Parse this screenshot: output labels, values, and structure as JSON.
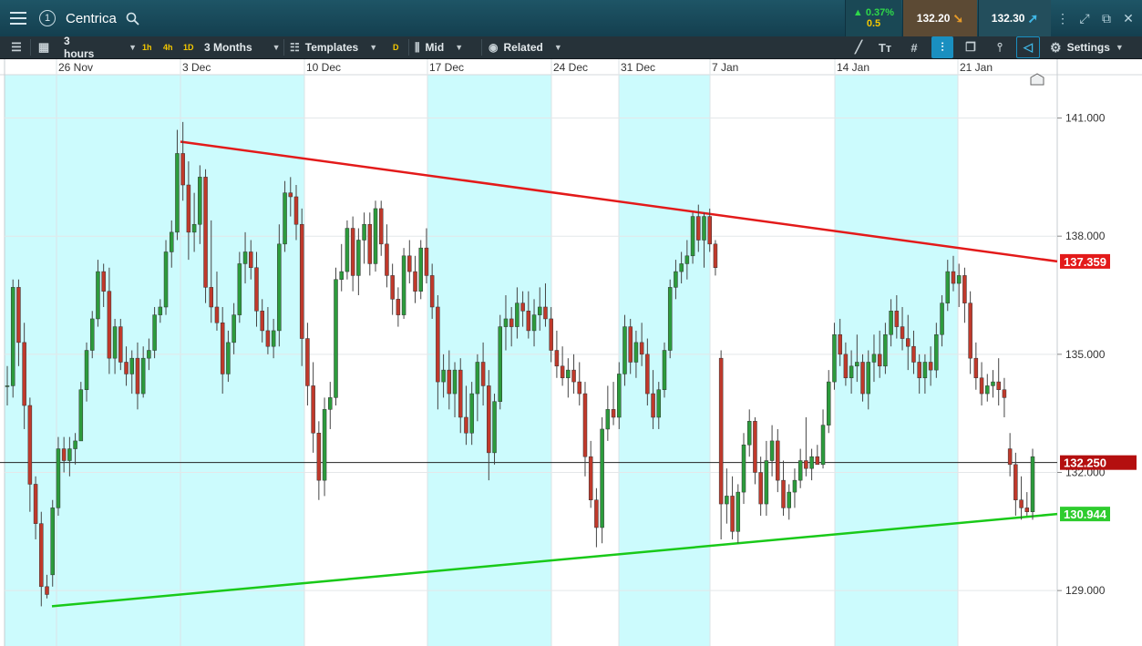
{
  "header": {
    "menu_icon": "hamburger-menu-icon",
    "alert_icon": "alert-circle-icon",
    "alert_label": "1",
    "title": "Centrica",
    "search_icon": "search-icon",
    "change_pct": "▲ 0.37%",
    "change_abs": "0.5",
    "sell_price": "132.20",
    "buy_price": "132.30",
    "window_icons": [
      "menu-dots-icon",
      "expand-icon",
      "popout-icon",
      "close-icon"
    ],
    "window_glyphs": [
      "⋮",
      "⤢",
      "⧉",
      "✕"
    ]
  },
  "toolbar": {
    "interval": "3 hours",
    "quick_1h": "1h",
    "quick_4h": "4h",
    "quick_1d": "1D",
    "range": "3 Months",
    "templates": "Templates",
    "d_label": "D",
    "price_type": "Mid",
    "related": "Related",
    "settings": "Settings"
  },
  "colors": {
    "up": "#2c9b3c",
    "down": "#c0392b",
    "resistance": "#e31a1a",
    "support": "#19c919",
    "shade": "#ccfbfd",
    "current": "#b40f0f"
  },
  "chart_data": {
    "type": "candlestick",
    "x_labels": [
      "26 Nov",
      "3 Dec",
      "10 Dec",
      "17 Dec",
      "24 Dec",
      "31 Dec",
      "7 Jan",
      "14 Jan",
      "21 Jan"
    ],
    "y_ticks": [
      "141.000",
      "138.000",
      "135.000",
      "132.000",
      "129.000"
    ],
    "y_range": [
      127.8,
      142.1
    ],
    "current_price_label": "132.250",
    "current_price": 132.25,
    "resistance_label": "137.359",
    "resistance": {
      "from": {
        "date": "3 Dec",
        "price": 140.4
      },
      "to_price": 137.359
    },
    "support_label": "130.944",
    "support": {
      "from": {
        "date": "26 Nov",
        "price": 128.6
      },
      "to_price": 130.944
    },
    "shaded_weeks": [
      "26 Nov",
      "3 Dec",
      "17 Dec",
      "31 Dec",
      "14 Jan"
    ],
    "candles": [
      [
        134.2,
        134.7,
        133.7,
        134.2
      ],
      [
        134.2,
        136.9,
        133.9,
        136.7
      ],
      [
        136.7,
        136.9,
        134.7,
        135.3
      ],
      [
        135.3,
        135.8,
        133.1,
        133.7
      ],
      [
        133.7,
        133.9,
        131.0,
        131.7
      ],
      [
        131.7,
        131.9,
        130.3,
        130.7
      ],
      [
        130.7,
        131.0,
        128.6,
        129.1
      ],
      [
        129.1,
        129.4,
        128.8,
        128.9
      ],
      [
        129.4,
        131.3,
        129.1,
        131.1
      ],
      [
        131.1,
        132.9,
        130.9,
        132.6
      ],
      [
        132.6,
        132.9,
        132.0,
        132.3
      ],
      [
        132.3,
        132.9,
        131.9,
        132.6
      ],
      [
        132.6,
        133.0,
        132.2,
        132.8
      ],
      [
        132.8,
        134.3,
        132.8,
        134.1
      ],
      [
        134.1,
        135.3,
        133.8,
        135.1
      ],
      [
        135.1,
        136.1,
        134.9,
        135.9
      ],
      [
        135.9,
        137.4,
        135.7,
        137.1
      ],
      [
        137.1,
        137.3,
        136.2,
        136.6
      ],
      [
        136.6,
        137.2,
        134.5,
        134.9
      ],
      [
        134.9,
        135.9,
        134.5,
        135.7
      ],
      [
        135.7,
        135.9,
        134.6,
        134.8
      ],
      [
        134.8,
        135.2,
        134.2,
        134.5
      ],
      [
        134.5,
        135.1,
        134.0,
        134.9
      ],
      [
        134.9,
        135.3,
        133.6,
        134.0
      ],
      [
        134.0,
        135.2,
        133.9,
        134.9
      ],
      [
        134.9,
        135.4,
        134.6,
        135.1
      ],
      [
        135.1,
        136.2,
        134.9,
        136.0
      ],
      [
        136.0,
        136.4,
        135.8,
        136.2
      ],
      [
        136.2,
        137.9,
        136.0,
        137.6
      ],
      [
        137.6,
        138.4,
        137.2,
        138.1
      ],
      [
        138.1,
        140.7,
        137.9,
        140.1
      ],
      [
        140.1,
        140.9,
        138.9,
        139.3
      ],
      [
        139.3,
        139.9,
        137.4,
        138.1
      ],
      [
        138.1,
        139.1,
        137.6,
        138.3
      ],
      [
        138.3,
        139.8,
        137.8,
        139.5
      ],
      [
        139.5,
        139.7,
        136.3,
        136.7
      ],
      [
        136.7,
        138.4,
        135.8,
        136.2
      ],
      [
        136.2,
        137.1,
        135.6,
        135.8
      ],
      [
        135.8,
        136.2,
        134.0,
        134.5
      ],
      [
        134.5,
        135.6,
        134.3,
        135.3
      ],
      [
        135.3,
        136.3,
        135.0,
        136.0
      ],
      [
        136.0,
        137.6,
        135.8,
        137.3
      ],
      [
        137.3,
        138.1,
        136.8,
        137.6
      ],
      [
        137.6,
        137.9,
        136.9,
        137.2
      ],
      [
        137.2,
        137.6,
        135.7,
        136.1
      ],
      [
        136.1,
        136.4,
        135.3,
        135.6
      ],
      [
        135.6,
        136.2,
        135.0,
        135.2
      ],
      [
        135.2,
        135.9,
        134.9,
        135.6
      ],
      [
        135.6,
        138.3,
        135.2,
        137.8
      ],
      [
        137.8,
        139.4,
        137.6,
        139.1
      ],
      [
        139.1,
        139.5,
        138.5,
        139.0
      ],
      [
        139.0,
        139.3,
        137.9,
        138.3
      ],
      [
        138.3,
        138.7,
        134.7,
        135.4
      ],
      [
        135.4,
        135.8,
        133.7,
        134.2
      ],
      [
        134.2,
        134.8,
        132.5,
        133.0
      ],
      [
        133.0,
        133.3,
        131.3,
        131.8
      ],
      [
        131.8,
        133.9,
        131.4,
        133.6
      ],
      [
        133.6,
        134.3,
        133.1,
        133.9
      ],
      [
        133.9,
        137.2,
        133.7,
        136.9
      ],
      [
        136.9,
        137.8,
        136.6,
        137.1
      ],
      [
        137.1,
        138.4,
        136.9,
        138.2
      ],
      [
        138.2,
        138.5,
        136.6,
        137.0
      ],
      [
        137.0,
        138.2,
        136.5,
        137.9
      ],
      [
        137.9,
        138.6,
        137.3,
        138.3
      ],
      [
        138.3,
        138.6,
        137.0,
        137.3
      ],
      [
        137.3,
        138.9,
        137.1,
        138.7
      ],
      [
        138.7,
        138.9,
        137.5,
        137.8
      ],
      [
        137.8,
        138.3,
        136.7,
        137.0
      ],
      [
        137.0,
        137.3,
        136.0,
        136.4
      ],
      [
        136.4,
        136.7,
        135.7,
        136.0
      ],
      [
        136.0,
        137.7,
        135.9,
        137.5
      ],
      [
        137.5,
        137.9,
        136.8,
        137.1
      ],
      [
        137.1,
        137.5,
        136.3,
        136.6
      ],
      [
        136.6,
        137.9,
        136.4,
        137.7
      ],
      [
        137.7,
        138.2,
        136.8,
        137.0
      ],
      [
        137.0,
        137.3,
        135.9,
        136.2
      ],
      [
        136.2,
        136.5,
        133.6,
        134.3
      ],
      [
        134.3,
        135.0,
        133.9,
        134.6
      ],
      [
        134.6,
        135.1,
        133.6,
        134.0
      ],
      [
        134.0,
        134.8,
        133.4,
        134.6
      ],
      [
        134.6,
        134.9,
        133.0,
        133.4
      ],
      [
        133.4,
        134.2,
        132.7,
        133.0
      ],
      [
        133.0,
        134.3,
        132.7,
        134.0
      ],
      [
        134.0,
        135.0,
        133.3,
        134.8
      ],
      [
        134.8,
        135.3,
        133.7,
        134.2
      ],
      [
        134.2,
        134.6,
        131.8,
        132.5
      ],
      [
        132.5,
        134.0,
        132.2,
        133.8
      ],
      [
        133.8,
        136.0,
        133.6,
        135.7
      ],
      [
        135.7,
        136.5,
        135.1,
        135.9
      ],
      [
        135.9,
        136.2,
        135.2,
        135.7
      ],
      [
        135.7,
        136.7,
        135.4,
        136.3
      ],
      [
        136.3,
        136.6,
        135.7,
        136.1
      ],
      [
        136.1,
        136.6,
        135.4,
        135.6
      ],
      [
        135.6,
        136.4,
        135.2,
        136.0
      ],
      [
        136.0,
        136.7,
        135.6,
        136.2
      ],
      [
        136.2,
        136.8,
        135.7,
        135.9
      ],
      [
        135.9,
        136.2,
        134.8,
        135.1
      ],
      [
        135.1,
        135.6,
        134.4,
        134.7
      ],
      [
        134.7,
        135.2,
        134.2,
        134.4
      ],
      [
        134.4,
        134.9,
        133.9,
        134.6
      ],
      [
        134.6,
        135.0,
        134.0,
        134.3
      ],
      [
        134.3,
        134.8,
        133.7,
        134.0
      ],
      [
        134.0,
        134.3,
        131.9,
        132.4
      ],
      [
        132.4,
        132.8,
        131.1,
        131.3
      ],
      [
        131.3,
        131.6,
        130.1,
        130.6
      ],
      [
        130.6,
        133.4,
        130.2,
        133.1
      ],
      [
        133.1,
        134.2,
        132.8,
        133.6
      ],
      [
        133.6,
        134.3,
        133.2,
        133.4
      ],
      [
        133.4,
        134.8,
        133.1,
        134.5
      ],
      [
        134.5,
        136.0,
        134.2,
        135.7
      ],
      [
        135.7,
        135.9,
        134.5,
        134.8
      ],
      [
        134.8,
        135.6,
        134.4,
        135.3
      ],
      [
        135.3,
        135.8,
        134.7,
        135.0
      ],
      [
        135.0,
        135.4,
        133.7,
        134.0
      ],
      [
        134.0,
        134.6,
        133.1,
        133.4
      ],
      [
        133.4,
        134.3,
        133.1,
        134.1
      ],
      [
        134.1,
        135.3,
        133.9,
        135.1
      ],
      [
        135.1,
        136.9,
        134.9,
        136.7
      ],
      [
        136.7,
        137.4,
        136.4,
        137.1
      ],
      [
        137.1,
        137.6,
        136.8,
        137.3
      ],
      [
        137.3,
        137.9,
        136.9,
        137.5
      ],
      [
        137.5,
        138.6,
        137.3,
        138.5
      ],
      [
        138.5,
        138.8,
        137.6,
        137.9
      ],
      [
        137.9,
        138.6,
        137.2,
        138.5
      ],
      [
        138.5,
        138.7,
        137.6,
        137.8
      ],
      [
        137.8,
        137.9,
        137.0,
        137.2
      ],
      [
        134.9,
        135.1,
        130.3,
        131.2
      ],
      [
        131.2,
        132.1,
        130.7,
        131.4
      ],
      [
        131.4,
        131.9,
        130.3,
        130.5
      ],
      [
        130.5,
        131.7,
        130.2,
        131.5
      ],
      [
        131.5,
        133.0,
        131.2,
        132.7
      ],
      [
        132.7,
        133.6,
        132.4,
        133.3
      ],
      [
        133.3,
        133.4,
        131.7,
        132.0
      ],
      [
        132.0,
        132.4,
        130.9,
        131.2
      ],
      [
        131.2,
        132.8,
        130.9,
        132.3
      ],
      [
        132.3,
        133.2,
        131.9,
        132.8
      ],
      [
        132.8,
        133.1,
        131.5,
        131.8
      ],
      [
        131.8,
        132.3,
        130.9,
        131.1
      ],
      [
        131.1,
        131.7,
        130.8,
        131.5
      ],
      [
        131.5,
        132.1,
        131.1,
        131.8
      ],
      [
        131.8,
        132.6,
        131.6,
        132.3
      ],
      [
        132.3,
        133.4,
        131.9,
        132.1
      ],
      [
        132.1,
        132.6,
        131.8,
        132.4
      ],
      [
        132.4,
        132.7,
        132.2,
        132.2
      ],
      [
        132.2,
        133.6,
        132.1,
        133.2
      ],
      [
        133.2,
        134.6,
        133.0,
        134.3
      ],
      [
        134.3,
        135.8,
        134.1,
        135.5
      ],
      [
        135.5,
        135.9,
        134.7,
        135.0
      ],
      [
        135.0,
        135.3,
        134.2,
        134.4
      ],
      [
        134.4,
        135.1,
        134.0,
        134.7
      ],
      [
        134.7,
        135.5,
        134.3,
        134.8
      ],
      [
        134.8,
        135.0,
        133.8,
        134.0
      ],
      [
        134.0,
        135.1,
        133.6,
        134.8
      ],
      [
        134.8,
        135.5,
        134.3,
        135.0
      ],
      [
        135.0,
        135.6,
        134.4,
        134.7
      ],
      [
        134.7,
        135.8,
        134.5,
        135.5
      ],
      [
        135.5,
        136.4,
        135.2,
        136.1
      ],
      [
        136.1,
        136.5,
        135.4,
        135.7
      ],
      [
        135.7,
        136.2,
        135.1,
        135.4
      ],
      [
        135.4,
        136.0,
        134.6,
        135.2
      ],
      [
        135.2,
        135.6,
        134.5,
        134.8
      ],
      [
        134.8,
        135.0,
        134.0,
        134.4
      ],
      [
        134.4,
        135.0,
        134.0,
        134.8
      ],
      [
        134.8,
        135.2,
        134.2,
        134.6
      ],
      [
        134.6,
        135.8,
        134.4,
        135.5
      ],
      [
        135.5,
        136.5,
        135.2,
        136.3
      ],
      [
        136.3,
        137.4,
        136.1,
        137.1
      ],
      [
        137.1,
        137.5,
        136.6,
        136.8
      ],
      [
        136.8,
        137.3,
        136.2,
        137.0
      ],
      [
        137.0,
        137.2,
        135.8,
        136.3
      ],
      [
        136.3,
        136.6,
        134.5,
        134.9
      ],
      [
        134.9,
        135.3,
        134.1,
        134.4
      ],
      [
        134.4,
        134.8,
        133.7,
        134.0
      ],
      [
        134.0,
        134.5,
        133.8,
        134.2
      ],
      [
        134.2,
        134.6,
        133.9,
        134.3
      ],
      [
        134.3,
        134.9,
        133.7,
        134.1
      ],
      [
        134.1,
        134.4,
        133.4,
        133.9
      ],
      [
        132.6,
        133.0,
        131.9,
        132.2
      ],
      [
        132.2,
        132.5,
        130.9,
        131.3
      ],
      [
        131.3,
        131.9,
        130.8,
        131.1
      ],
      [
        131.1,
        131.5,
        130.9,
        131.0
      ],
      [
        131.0,
        132.6,
        130.8,
        132.4
      ]
    ]
  }
}
